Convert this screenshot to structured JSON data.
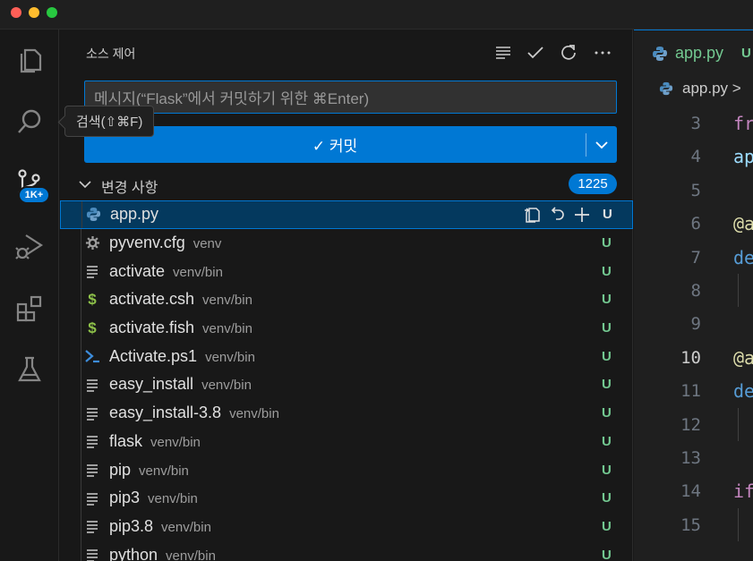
{
  "window": {
    "traffic_lights": {
      "close_color": "#ff5f57",
      "minimize_color": "#febc2e",
      "zoom_color": "#28c840"
    }
  },
  "activity_bar": {
    "items": [
      {
        "name": "explorer-icon"
      },
      {
        "name": "search-icon"
      },
      {
        "name": "source-control-icon",
        "badge": "1K+"
      },
      {
        "name": "run-debug-icon"
      },
      {
        "name": "extensions-icon"
      },
      {
        "name": "testing-icon"
      }
    ],
    "tooltip": "검색(⇧⌘F)"
  },
  "scm": {
    "title": "소스 제어",
    "toolbar": [
      "view-as-tree-icon",
      "commit-check-icon",
      "refresh-icon",
      "more-actions-icon"
    ],
    "commit_placeholder": "메시지(“Flask”에서 커밋하기 위한 ⌘Enter)",
    "commit_button": "✓ 커밋",
    "changes": {
      "label": "변경 사항",
      "count": "1225",
      "files": [
        {
          "name": "app.py",
          "dir": "",
          "icon": "python-icon",
          "status": "U",
          "selected": true
        },
        {
          "name": "pyvenv.cfg",
          "dir": "venv",
          "icon": "gear-icon",
          "status": "U"
        },
        {
          "name": "activate",
          "dir": "venv/bin",
          "icon": "text-lines-icon",
          "status": "U"
        },
        {
          "name": "activate.csh",
          "dir": "venv/bin",
          "icon": "shell-dollar-icon",
          "status": "U"
        },
        {
          "name": "activate.fish",
          "dir": "venv/bin",
          "icon": "shell-dollar-icon",
          "status": "U"
        },
        {
          "name": "Activate.ps1",
          "dir": "venv/bin",
          "icon": "powershell-icon",
          "status": "U"
        },
        {
          "name": "easy_install",
          "dir": "venv/bin",
          "icon": "text-lines-icon",
          "status": "U"
        },
        {
          "name": "easy_install-3.8",
          "dir": "venv/bin",
          "icon": "text-lines-icon",
          "status": "U"
        },
        {
          "name": "flask",
          "dir": "venv/bin",
          "icon": "text-lines-icon",
          "status": "U"
        },
        {
          "name": "pip",
          "dir": "venv/bin",
          "icon": "text-lines-icon",
          "status": "U"
        },
        {
          "name": "pip3",
          "dir": "venv/bin",
          "icon": "text-lines-icon",
          "status": "U"
        },
        {
          "name": "pip3.8",
          "dir": "venv/bin",
          "icon": "text-lines-icon",
          "status": "U"
        },
        {
          "name": "python",
          "dir": "venv/bin",
          "icon": "text-lines-icon",
          "status": "U"
        }
      ]
    }
  },
  "editor": {
    "tab": {
      "name": "app.py",
      "status": "U"
    },
    "breadcrumb": "app.py >",
    "lines": [
      {
        "n": "3",
        "code": "fr",
        "color": "#c586c0"
      },
      {
        "n": "4",
        "code": "ap",
        "color": "#9cdcfe"
      },
      {
        "n": "5",
        "code": "",
        "color": "#cccccc"
      },
      {
        "n": "6",
        "code": "@a",
        "color": "#dcdcaa"
      },
      {
        "n": "7",
        "code": "de",
        "color": "#569cd6"
      },
      {
        "n": "8",
        "code": "",
        "color": "#cccccc",
        "indent": true
      },
      {
        "n": "9",
        "code": "",
        "color": "#cccccc"
      },
      {
        "n": "10",
        "code": "@a",
        "color": "#dcdcaa",
        "active": true
      },
      {
        "n": "11",
        "code": "de",
        "color": "#569cd6"
      },
      {
        "n": "12",
        "code": "",
        "color": "#cccccc",
        "indent": true
      },
      {
        "n": "13",
        "code": "",
        "color": "#cccccc"
      },
      {
        "n": "14",
        "code": "if",
        "color": "#c586c0"
      },
      {
        "n": "15",
        "code": "",
        "color": "#cccccc",
        "indent": true
      }
    ]
  },
  "colors": {
    "accent": "#0078d4",
    "untracked": "#73c991"
  }
}
